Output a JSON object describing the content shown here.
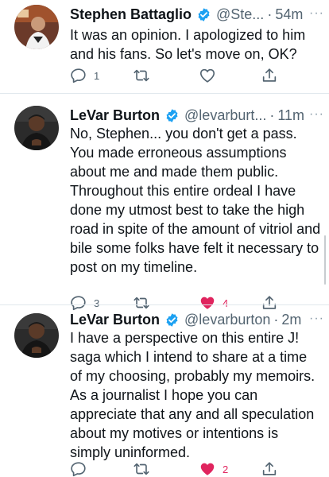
{
  "tweets": [
    {
      "name": "Stephen Battaglio",
      "handle": "@Ste...",
      "time": "54m",
      "text": "It was an opinion. I apologized to him and his fans. So let's move on, OK?",
      "reply_count": "1",
      "retweet_count": "",
      "like_count": "",
      "liked": false
    },
    {
      "name": "LeVar Burton",
      "handle": "@levarburt...",
      "time": "11m",
      "text": "No, Stephen... you don't get a pass. You made erroneous assumptions about me and made them public. Throughout this entire ordeal I have done my utmost best to take the high road in spite of the amount of vitriol and bile some folks have felt it necessary to post on my timeline.",
      "reply_count": "3",
      "retweet_count": "",
      "like_count": "4",
      "liked": true
    },
    {
      "name": "LeVar Burton",
      "handle": "@levarburton",
      "time": "2m",
      "text": "I have a perspective on this entire J! saga which I intend to share at a time of my choosing, probably my memoirs. As a journalist I hope you can appreciate that any and all speculation about my motives or intentions is simply uninformed.",
      "reply_count": "",
      "retweet_count": "",
      "like_count": "2",
      "liked": true
    }
  ],
  "separator_dot": "·",
  "more_glyph": "···",
  "colors": {
    "verified": "#1da1f2",
    "liked": "#e0245e",
    "icon": "#536471",
    "text": "#0f1419",
    "secondary": "#536471"
  },
  "icons": [
    "verified-badge-icon",
    "reply-icon",
    "retweet-icon",
    "like-icon",
    "share-icon",
    "more-icon"
  ]
}
